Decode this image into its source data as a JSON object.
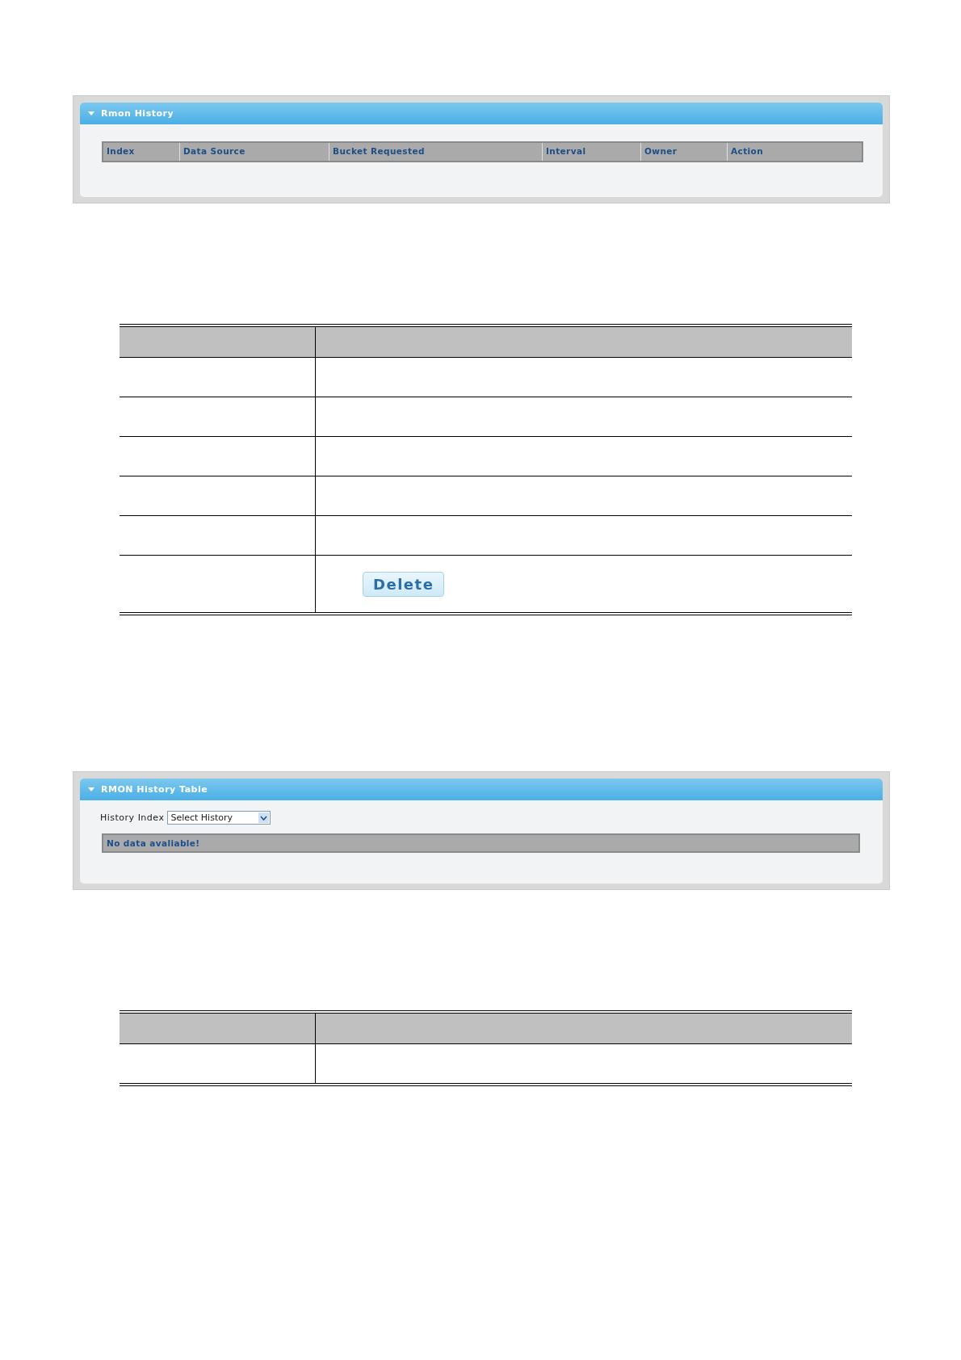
{
  "rmon_history_panel": {
    "title": "Rmon History",
    "expanded": true,
    "columns": [
      "Index",
      "Data Source",
      "Bucket Requested",
      "Interval",
      "Owner",
      "Action"
    ]
  },
  "description_table_1": {
    "rows": [
      {
        "kind": "header"
      },
      {
        "kind": "blank"
      },
      {
        "kind": "blank"
      },
      {
        "kind": "blank"
      },
      {
        "kind": "blank"
      },
      {
        "kind": "blank"
      },
      {
        "kind": "button",
        "button": "Delete"
      }
    ]
  },
  "rmon_history_table_panel": {
    "title": "RMON History Table",
    "expanded": true,
    "history_index_label": "History Index",
    "history_index_value": "Select History",
    "message": "No data avaliable!"
  },
  "description_table_2": {
    "rows": [
      {
        "kind": "header"
      },
      {
        "kind": "blank"
      }
    ]
  }
}
